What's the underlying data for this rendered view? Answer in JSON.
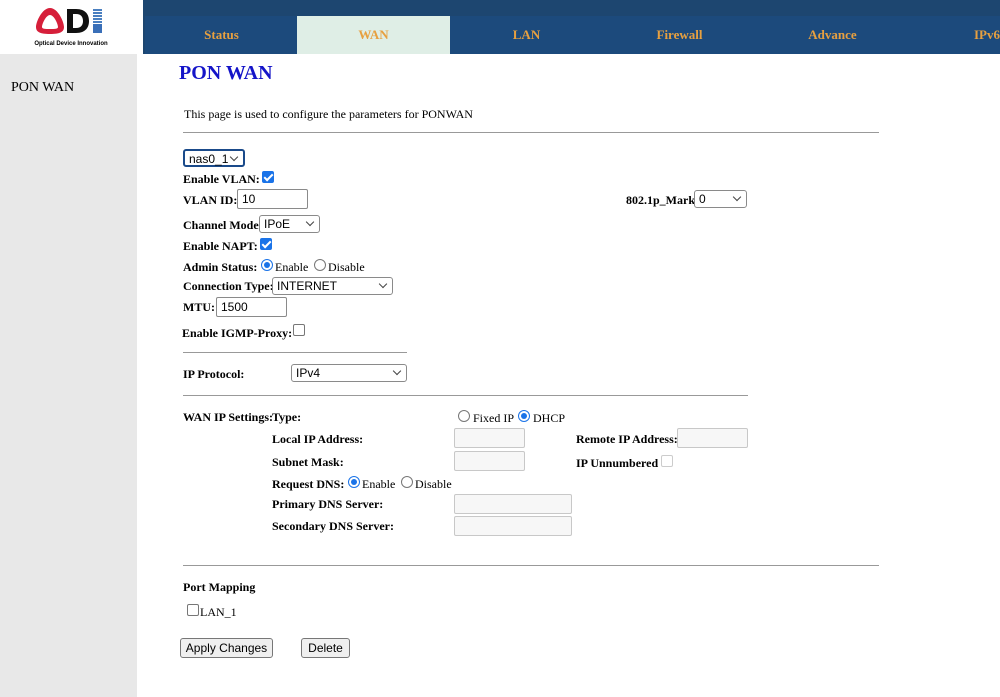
{
  "logo": {
    "text": "ODI",
    "tagline": "Optical Device Innovation"
  },
  "nav": {
    "tabs": [
      {
        "label": "Status"
      },
      {
        "label": "WAN"
      },
      {
        "label": "LAN"
      },
      {
        "label": "Firewall"
      },
      {
        "label": "Advance"
      },
      {
        "label": "IPv6"
      }
    ],
    "active": "WAN"
  },
  "sidebar": {
    "items": [
      {
        "label": "PON WAN"
      }
    ]
  },
  "page": {
    "title": "PON WAN",
    "description": "This page is used to configure the parameters for PONWAN"
  },
  "form": {
    "interface": "nas0_1",
    "enable_vlan_label": "Enable VLAN:",
    "enable_vlan": true,
    "vlan_id_label": "VLAN ID:",
    "vlan_id": "10",
    "mark_label": "802.1p_Mark",
    "mark": "0",
    "channel_mode_label": "Channel Mode:",
    "channel_mode": "IPoE",
    "enable_napt_label": "Enable NAPT:",
    "enable_napt": true,
    "admin_status_label": "Admin Status:",
    "enable_label": "Enable",
    "disable_label": "Disable",
    "admin_status": "Enable",
    "connection_type_label": "Connection Type:",
    "connection_type": "INTERNET",
    "mtu_label": "MTU:",
    "mtu": "1500",
    "igmp_label": "Enable IGMP-Proxy:",
    "igmp": false,
    "ip_protocol_label": "IP Protocol:",
    "ip_protocol": "IPv4",
    "wan_ip_label": "WAN IP Settings:",
    "type_label": "Type:",
    "fixed_ip_label": "Fixed IP",
    "dhcp_label": "DHCP",
    "type": "DHCP",
    "local_ip_label": "Local IP Address:",
    "remote_ip_label": "Remote IP Address:",
    "subnet_label": "Subnet Mask:",
    "ip_unnumbered_label": "IP Unnumbered",
    "request_dns_label": "Request DNS:",
    "request_dns": "Enable",
    "primary_dns_label": "Primary DNS Server:",
    "secondary_dns_label": "Secondary DNS Server:",
    "port_mapping_label": "Port Mapping",
    "lan1_label": "LAN_1",
    "lan1": false,
    "apply_label": "Apply Changes",
    "delete_label": "Delete"
  },
  "colors": {
    "nav_bg": "#1c4a7c",
    "tab_text": "#e7a040",
    "active_tab_bg": "#dfeee6",
    "title": "#1414c8",
    "accent": "#1a73e8"
  }
}
